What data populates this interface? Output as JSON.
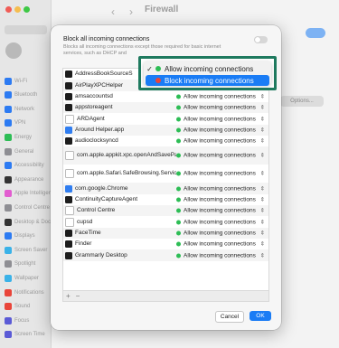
{
  "background": {
    "title": "Firewall",
    "options_label": "Options...",
    "sidebar": [
      {
        "label": "Wi-Fi",
        "color": "#2d7bf2"
      },
      {
        "label": "Bluetooth",
        "color": "#2d7bf2"
      },
      {
        "label": "Network",
        "color": "#2d7bf2"
      },
      {
        "label": "VPN",
        "color": "#2d7bf2"
      },
      {
        "label": "Energy",
        "color": "#2dbd55"
      },
      {
        "label": "General",
        "color": "#8e8e93"
      },
      {
        "label": "Accessibility",
        "color": "#2d7bf2"
      },
      {
        "label": "Appearance",
        "color": "#333333"
      },
      {
        "label": "Apple Intelligence",
        "color": "#e25dd0"
      },
      {
        "label": "Control Centre",
        "color": "#8e8e93"
      },
      {
        "label": "Desktop & Dock",
        "color": "#333333"
      },
      {
        "label": "Displays",
        "color": "#2d7bf2"
      },
      {
        "label": "Screen Saver",
        "color": "#3ab2e8"
      },
      {
        "label": "Spotlight",
        "color": "#8e8e93"
      },
      {
        "label": "Wallpaper",
        "color": "#3ab2e8"
      },
      {
        "label": "Notifications",
        "color": "#e9453a"
      },
      {
        "label": "Sound",
        "color": "#e9453a"
      },
      {
        "label": "Focus",
        "color": "#5b5bd6"
      },
      {
        "label": "Screen Time",
        "color": "#5b5bd6"
      }
    ]
  },
  "dialog": {
    "block_all_title": "Block all incoming connections",
    "block_all_desc": "Blocks all incoming connections except those required for basic internet services, such as DHCP and",
    "cancel_label": "Cancel",
    "ok_label": "OK",
    "add_label": "+",
    "remove_label": "−",
    "status_label": "Allow incoming connections",
    "stepper_glyph": "⇕",
    "apps": [
      {
        "name": "AddressBookSourceS",
        "icon": "black",
        "status": ""
      },
      {
        "name": "AirPlayXPCHelper",
        "icon": "black",
        "status": ""
      },
      {
        "name": "amsaccountsd",
        "icon": "black",
        "status": "Allow incoming connections"
      },
      {
        "name": "appstoreagent",
        "icon": "black",
        "status": "Allow incoming connections"
      },
      {
        "name": "ARDAgent",
        "icon": "white",
        "status": "Allow incoming connections"
      },
      {
        "name": "Around Helper.app",
        "icon": "blue",
        "status": "Allow incoming connections"
      },
      {
        "name": "audioclocksyncd",
        "icon": "black",
        "status": "Allow incoming connections"
      },
      {
        "name": "com.apple.appkit.xpc.openAndSavePanelService",
        "icon": "white",
        "status": "Allow incoming connections",
        "tall": true
      },
      {
        "name": "com.apple.Safari.SafeBrowsing.Service.app",
        "icon": "white",
        "status": "Allow incoming connections",
        "tall": true
      },
      {
        "name": "com.google.Chrome",
        "icon": "blue",
        "status": "Allow incoming connections"
      },
      {
        "name": "ContinuityCaptureAgent",
        "icon": "black",
        "status": "Allow incoming connections"
      },
      {
        "name": "Control Centre",
        "icon": "white",
        "status": "Allow incoming connections"
      },
      {
        "name": "cupsd",
        "icon": "white",
        "status": "Allow incoming connections"
      },
      {
        "name": "FaceTime",
        "icon": "black",
        "status": "Allow incoming connections"
      },
      {
        "name": "Finder",
        "icon": "black",
        "status": "Allow incoming connections"
      },
      {
        "name": "Grammarly Desktop",
        "icon": "black",
        "status": "Allow incoming connections"
      }
    ]
  },
  "popup": {
    "items": [
      {
        "label": "Allow incoming connections",
        "checked": true,
        "dot_color": "#2dbd55"
      },
      {
        "label": "Block incoming connections",
        "checked": false,
        "dot_color": "#e9453a"
      }
    ],
    "highlight_color": "#1f7a5f"
  }
}
